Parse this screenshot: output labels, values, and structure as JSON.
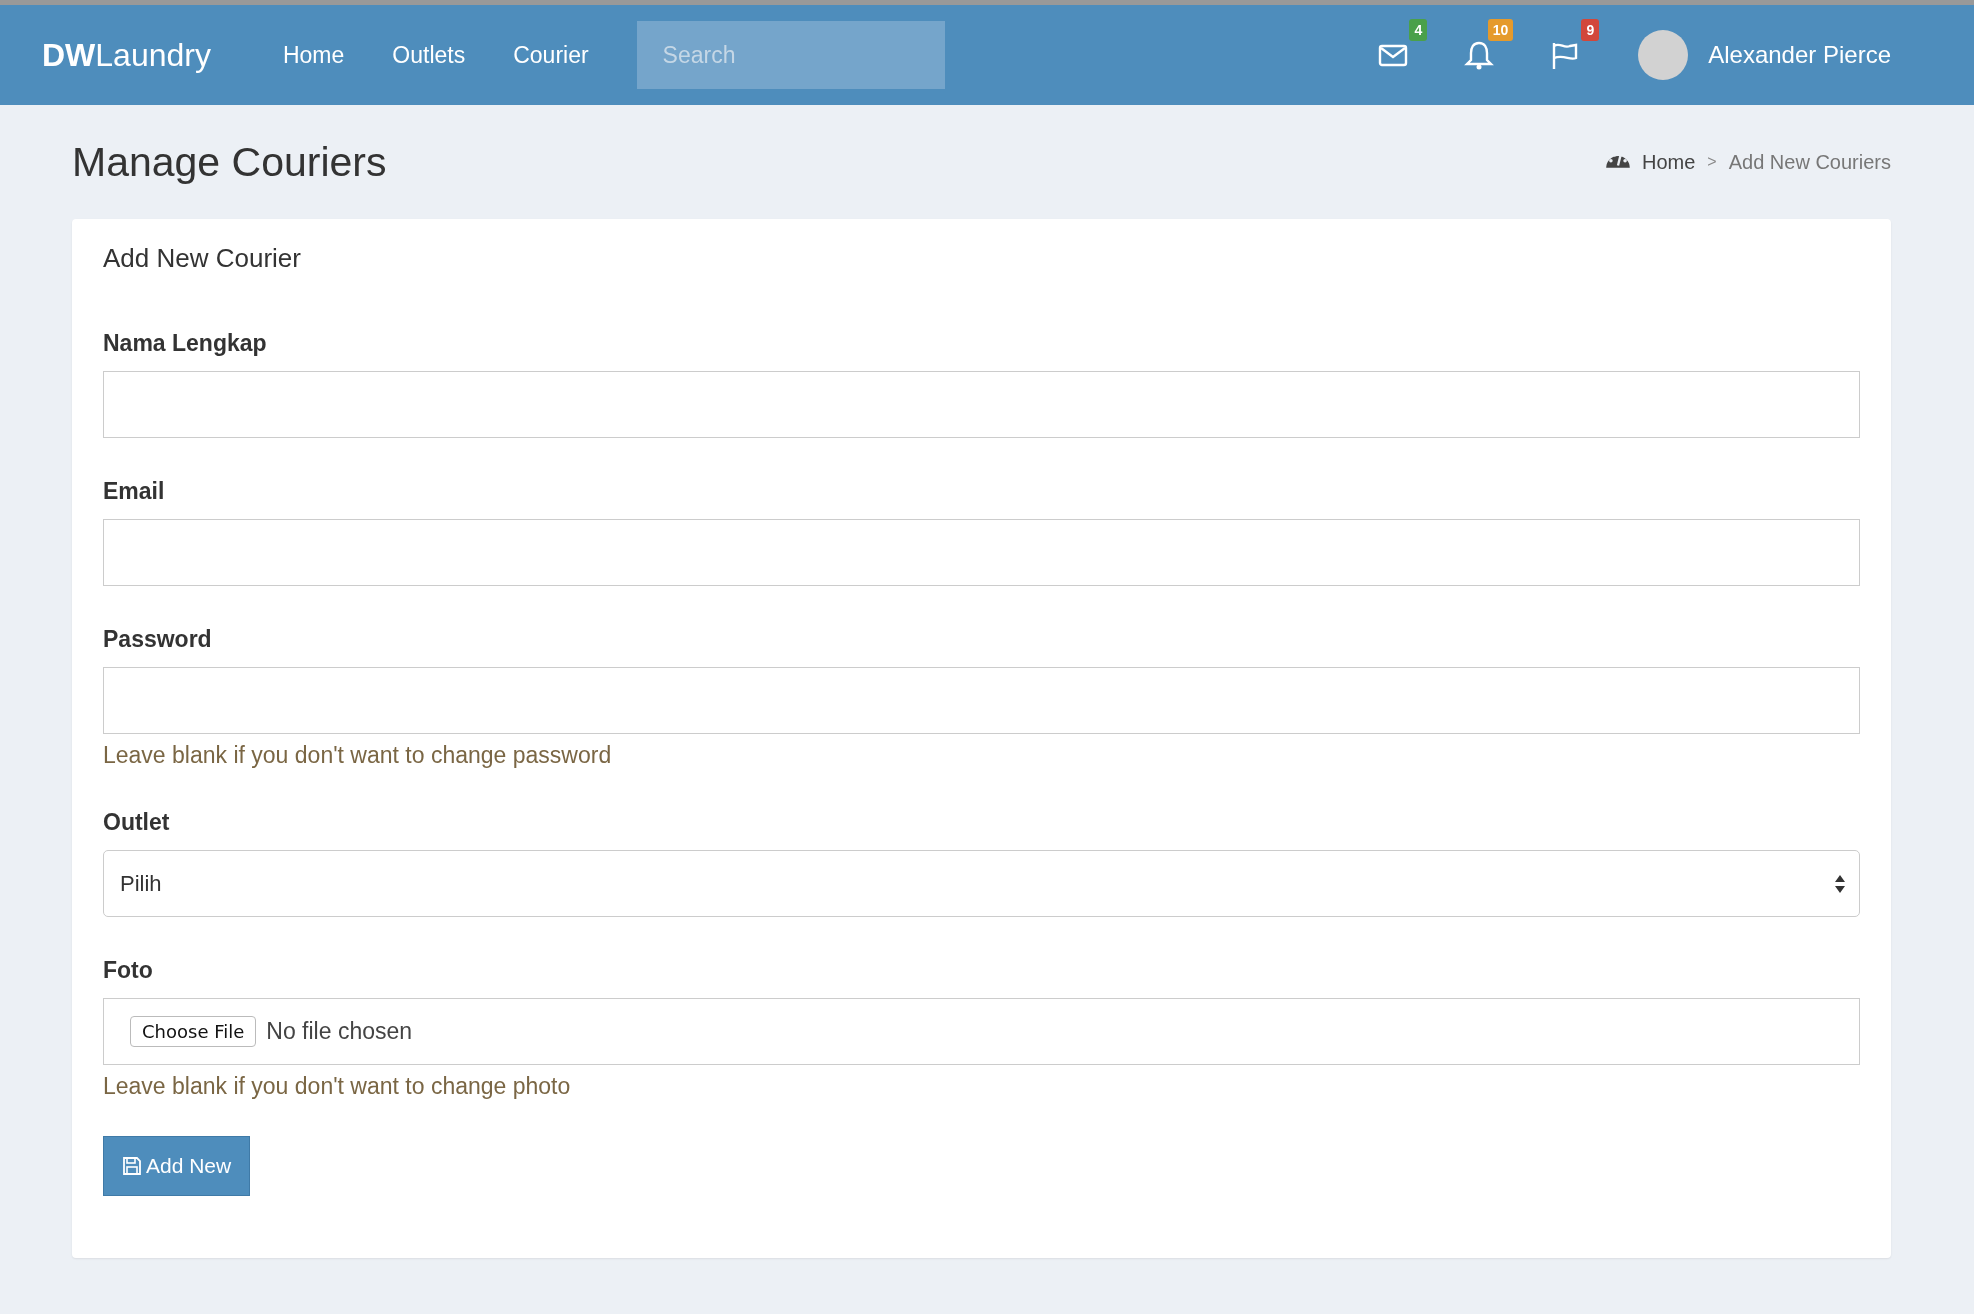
{
  "navbar": {
    "logo_bold": "DW",
    "logo_rest": "Laundry",
    "links": [
      {
        "label": "Home"
      },
      {
        "label": "Outlets"
      },
      {
        "label": "Courier"
      }
    ],
    "search": {
      "placeholder": "Search"
    },
    "notifications": [
      {
        "kind": "mail",
        "count": "4",
        "color": "#4aa04a"
      },
      {
        "kind": "bell",
        "count": "10",
        "color": "#e59a2b"
      },
      {
        "kind": "flag",
        "count": "9",
        "color": "#d2473a"
      }
    ],
    "user": {
      "name": "Alexander Pierce"
    }
  },
  "page": {
    "title": "Manage Couriers",
    "breadcrumb": [
      {
        "label": "Home"
      },
      {
        "label": "Add New Couriers"
      }
    ],
    "breadcrumb_separator": ">"
  },
  "form": {
    "title": "Add New Courier",
    "fields": [
      {
        "kind": "text",
        "label": "Nama Lengkap"
      },
      {
        "kind": "text",
        "label": "Email"
      },
      {
        "kind": "password",
        "label": "Password",
        "help": "Leave blank if you don't want to change password"
      },
      {
        "kind": "select",
        "label": "Outlet",
        "value": "Pilih"
      },
      {
        "kind": "file",
        "label": "Foto",
        "button": "Choose File",
        "status": "No file chosen",
        "help": "Leave blank if you don't want to change photo"
      }
    ],
    "submit": "Add New"
  }
}
